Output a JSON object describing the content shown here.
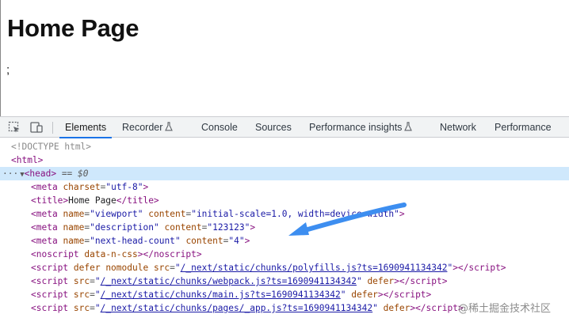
{
  "page": {
    "title": "Home Page",
    "body_text": ";"
  },
  "toolbar": {
    "icons": [
      "inspect-element-icon",
      "device-toolbar-icon"
    ],
    "tabs": [
      {
        "label": "Elements",
        "active": true
      },
      {
        "label": "Recorder",
        "experimental": true
      },
      {
        "label": "Console"
      },
      {
        "label": "Sources"
      },
      {
        "label": "Performance insights",
        "experimental": true
      },
      {
        "label": "Network"
      },
      {
        "label": "Performance"
      }
    ]
  },
  "elements": {
    "doctype": "<!DOCTYPE html>",
    "html_open": "<html>",
    "head_line": {
      "ellipsis": "···",
      "tag": "<head>",
      "eq": "==",
      "var": "$0"
    },
    "meta_charset": {
      "name": "charset",
      "value": "utf-8"
    },
    "title": {
      "text": "Home Page"
    },
    "meta_viewport": {
      "name_value": "viewport",
      "content_value": "initial-scale=1.0, width=device-width"
    },
    "meta_description": {
      "name_value": "description",
      "content_value": "123123"
    },
    "meta_next_head_count": {
      "name_value": "next-head-count",
      "content_value": "4"
    },
    "noscript": {
      "attr": "data-n-css"
    },
    "script_polyfills": {
      "src": "/_next/static/chunks/polyfills.js?ts=1690941134342"
    },
    "script_webpack": {
      "src": "/_next/static/chunks/webpack.js?ts=1690941134342"
    },
    "script_main": {
      "src": "/_next/static/chunks/main.js?ts=1690941134342"
    },
    "script_app": {
      "src": "/_next/static/chunks/pages/_app.js?ts=1690941134342"
    }
  },
  "annotation": {
    "arrow_color": "#3d8ef0"
  },
  "watermark": "@稀土掘金技术社区"
}
